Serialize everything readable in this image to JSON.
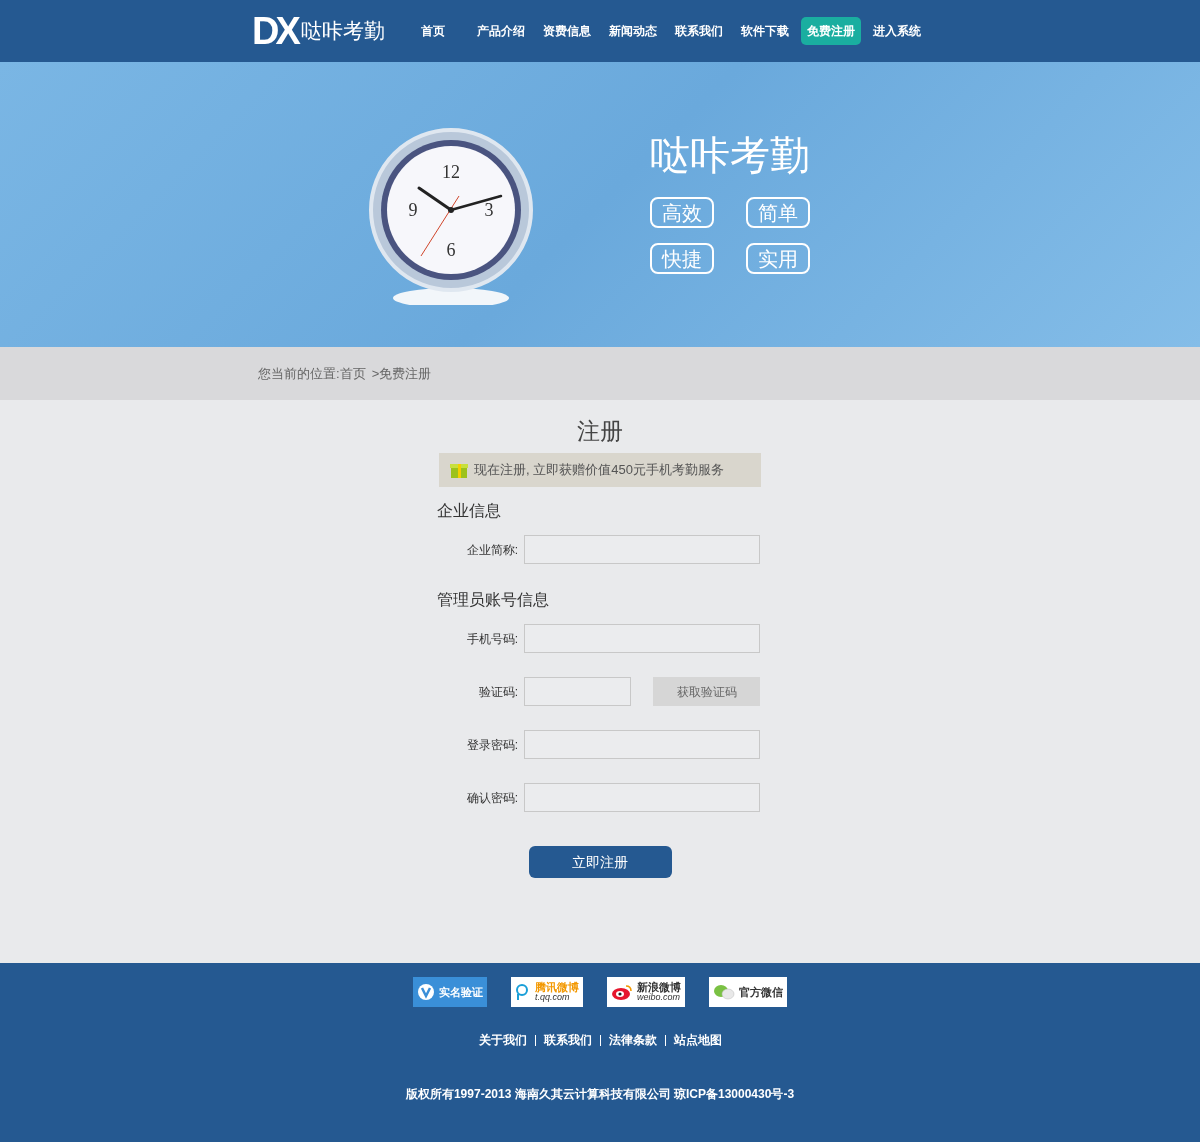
{
  "header": {
    "logo_mark": "DX",
    "logo_text": "哒咔考勤",
    "nav": [
      {
        "label": "首页",
        "selected": false
      },
      {
        "label": "产品介绍",
        "selected": false
      },
      {
        "label": "资费信息",
        "selected": false
      },
      {
        "label": "新闻动态",
        "selected": false
      },
      {
        "label": "联系我们",
        "selected": false
      },
      {
        "label": "软件下载",
        "selected": false
      },
      {
        "label": "免费注册",
        "selected": true
      },
      {
        "label": "进入系统",
        "selected": false
      }
    ]
  },
  "banner": {
    "clock_numerals": [
      "12",
      "3",
      "6",
      "9"
    ],
    "title": "哒咔考勤",
    "tags": [
      "高效",
      "简单",
      "快捷",
      "实用"
    ]
  },
  "breadcrumb": {
    "prefix": "您当前的位置:",
    "items": [
      "首页",
      ">免费注册"
    ]
  },
  "form": {
    "title": "注册",
    "promo": "现在注册, 立即获赠价值450元手机考勤服务",
    "sections": [
      {
        "heading": "企业信息",
        "fields": [
          {
            "label": "企业简称:",
            "kind": "text"
          }
        ]
      },
      {
        "heading": "管理员账号信息",
        "fields": [
          {
            "label": "手机号码:",
            "kind": "text"
          },
          {
            "label": "验证码:",
            "kind": "code",
            "button": "获取验证码"
          },
          {
            "label": "登录密码:",
            "kind": "password"
          },
          {
            "label": "确认密码:",
            "kind": "password"
          }
        ]
      }
    ],
    "submit": "立即注册"
  },
  "footer": {
    "badges": [
      {
        "kind": "verify",
        "text": "实名验证"
      },
      {
        "kind": "tencent",
        "text": "腾讯微博",
        "sub": "t.qq.com"
      },
      {
        "kind": "sina",
        "text": "新浪微博",
        "sub": "weibo.com"
      },
      {
        "kind": "wechat",
        "text": "官方微信"
      }
    ],
    "links": [
      "关于我们",
      "联系我们",
      "法律条款",
      "站点地图"
    ],
    "copyright": "版权所有1997-2013 海南久其云计算科技有限公司 琼ICP备13000430号-3"
  }
}
